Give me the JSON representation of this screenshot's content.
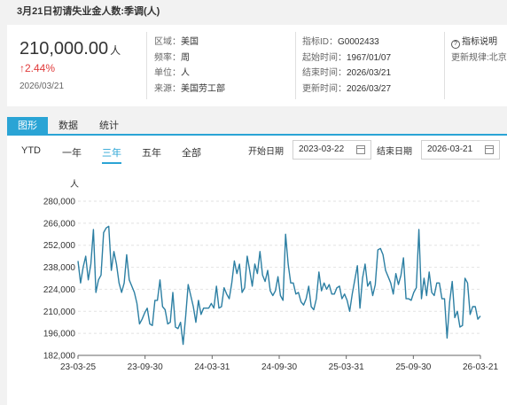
{
  "header": {
    "title": "3月21日初请失业金人数:季调(人)"
  },
  "summary": {
    "value": "210,000.00",
    "unit": "人",
    "change": "↑2.44%",
    "date": "2026/03/21",
    "meta_left": [
      {
        "key": "区域：",
        "value": "美国"
      },
      {
        "key": "频率：",
        "value": "周"
      },
      {
        "key": "单位：",
        "value": "人"
      },
      {
        "key": "来源：",
        "value": "美国劳工部"
      }
    ],
    "meta_right": [
      {
        "key": "指标ID：",
        "value": "G0002433"
      },
      {
        "key": "起始时间：",
        "value": "1967/01/07"
      },
      {
        "key": "结束时间：",
        "value": "2026/03/21"
      },
      {
        "key": "更新时间：",
        "value": "2026/03/27"
      }
    ],
    "help_label": "指标说明",
    "update_rule": "更新规律:北京"
  },
  "tabs": [
    "图形",
    "数据",
    "统计"
  ],
  "ranges": [
    "YTD",
    "一年",
    "三年",
    "五年",
    "全部"
  ],
  "active_range": 2,
  "date_filter": {
    "start_label": "开始日期",
    "start_value": "2023-03-22",
    "end_label": "结束日期",
    "end_value": "2026-03-21"
  },
  "colors": {
    "accent": "#2aa4d5",
    "line": "#2c7fa3",
    "up": "#e03a3a"
  },
  "chart_data": {
    "type": "line",
    "ylabel": "人",
    "ylim": [
      182000,
      280000
    ],
    "yticks": [
      "182,000",
      "196,000",
      "210,000",
      "224,000",
      "238,000",
      "252,000",
      "266,000",
      "280,000"
    ],
    "xticks": [
      "23-03-25",
      "23-09-30",
      "24-03-31",
      "24-09-30",
      "25-03-31",
      "25-09-30",
      "26-03-21"
    ],
    "grid": true,
    "series": [
      {
        "values": [
          242000,
          228000,
          238000,
          245000,
          230000,
          240000,
          262000,
          222000,
          230000,
          233000,
          260000,
          263000,
          264000,
          236000,
          248000,
          240000,
          228000,
          222000,
          228000,
          246000,
          230000,
          226000,
          222000,
          215000,
          202000,
          205000,
          209000,
          212000,
          202000,
          201000,
          217000,
          217000,
          230000,
          213000,
          211000,
          202000,
          203000,
          222000,
          200000,
          199000,
          203000,
          189000,
          207000,
          227000,
          220000,
          213000,
          203000,
          217000,
          208000,
          212000,
          212000,
          212000,
          215000,
          212000,
          226000,
          212000,
          213000,
          225000,
          221000,
          218000,
          228000,
          242000,
          234000,
          240000,
          222000,
          225000,
          245000,
          236000,
          226000,
          240000,
          234000,
          248000,
          233000,
          229000,
          236000,
          223000,
          220000,
          223000,
          232000,
          220000,
          217000,
          259000,
          240000,
          228000,
          228000,
          221000,
          222000,
          216000,
          214000,
          218000,
          226000,
          213000,
          211000,
          218000,
          235000,
          223000,
          228000,
          224000,
          227000,
          221000,
          221000,
          225000,
          226000,
          218000,
          221000,
          217000,
          210000,
          221000,
          230000,
          239000,
          212000,
          231000,
          240000,
          226000,
          229000,
          220000,
          227000,
          249000,
          250000,
          246000,
          236000,
          232000,
          228000,
          221000,
          234000,
          227000,
          233000,
          244000,
          218000,
          218000,
          217000,
          222000,
          225000,
          262000,
          218000,
          231000,
          220000,
          235000,
          222000,
          220000,
          228000,
          228000,
          218000,
          218000,
          193000,
          216000,
          229000,
          206000,
          210000,
          200000,
          201000,
          231000,
          228000,
          208000,
          213000,
          213000,
          205000,
          207000
        ]
      }
    ]
  }
}
